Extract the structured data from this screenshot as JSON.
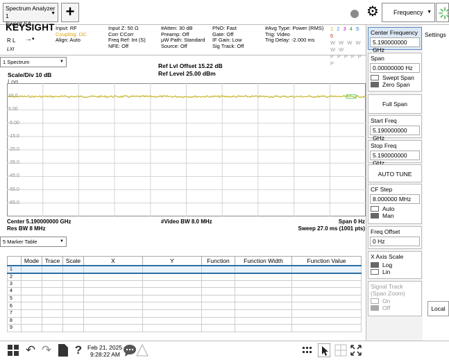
{
  "app_tab": {
    "title_line1": "Spectrum Analyzer 1",
    "title_line2": "Swept SA"
  },
  "toolbar": {
    "add": "+",
    "menu_select": "Frequency"
  },
  "meas_bar": {
    "brand": "KEYSIGHT",
    "rl": "R L",
    "lxi": "LXI",
    "col1": [
      "Input: RF",
      "Coupling: DC",
      "Align: Auto"
    ],
    "col2": [
      "Input Z: 50 Ω",
      "Corr CCorr",
      "Freq Ref: Int (S)",
      "NFE: Off"
    ],
    "col3": [
      "#Atten: 30 dB",
      "Preamp: Off",
      "μW Path: Standard",
      "Source: Off"
    ],
    "col4": [
      "PNO: Fast",
      "Gate: Off",
      "IF Gain: Low",
      "Sig Track: Off"
    ],
    "col5": [
      "#Avg Type: Power (RMS)",
      "Trig: Video",
      "Trig Delay: -2.000 ms"
    ],
    "trace_numbers": [
      "1",
      "2",
      "3",
      "4",
      "5",
      "6"
    ],
    "trace_types": "W W W W W W",
    "trace_det": "P P P P P P"
  },
  "window": {
    "select": "1 Spectrum",
    "ref_offset": "Ref Lvl Offset 15.22 dB",
    "ref_level": "Ref Level 25.00 dBm",
    "scale_div": "Scale/Div 10 dB",
    "log": "Log",
    "center": "Center 5.190000000 GHz",
    "res_bw": "Res BW 8 MHz",
    "video_bw": "#Video BW 8.0 MHz",
    "span": "Span 0 Hz",
    "sweep": "Sweep 27.0 ms (1001 pts)"
  },
  "chart_data": {
    "type": "line",
    "title": "",
    "xlabel": "",
    "ylabel": "",
    "y_tick_labels": [
      "15.0",
      "5.00",
      "-5.00",
      "-15.0",
      "-25.0",
      "-35.0",
      "-45.0",
      "-55.0",
      "-65.0"
    ],
    "ylim": [
      -75,
      25
    ],
    "grid": true,
    "series": [
      {
        "color": "#c9b400",
        "level": 15.0
      }
    ]
  },
  "marker_table": {
    "select": "5 Marker Table",
    "headers": [
      "",
      "Mode",
      "Trace",
      "Scale",
      "X",
      "Y",
      "Function",
      "Function Width",
      "Function Value"
    ],
    "rows": [
      "1",
      "2",
      "3",
      "4",
      "5",
      "6",
      "7",
      "8",
      "9"
    ]
  },
  "menu": {
    "settings_tab": "Settings",
    "center_freq_title": "Center Frequency",
    "center_freq_value": "5.190000000 GHz",
    "span_title": "Span",
    "span_value": "0.00000000 Hz",
    "swept_span": "Swept Span",
    "zero_span": "Zero Span",
    "full_span": "Full Span",
    "start_freq_title": "Start Freq",
    "start_freq_value": "5.190000000 GHz",
    "stop_freq_title": "Stop Freq",
    "stop_freq_value": "5.190000000 GHz",
    "auto_tune": "AUTO TUNE",
    "cf_step_title": "CF Step",
    "cf_step_value": "8.000000 MHz",
    "cf_auto": "Auto",
    "cf_man": "Man",
    "freq_offset_title": "Freq Offset",
    "freq_offset_value": "0 Hz",
    "x_axis_title": "X Axis Scale",
    "x_log": "Log",
    "x_lin": "Lin",
    "signal_track_title": "Signal Track",
    "signal_track_sub": "(Span Zoom)",
    "st_on": "On",
    "st_off": "Off",
    "local": "Local"
  },
  "taskbar": {
    "date": "Feb 21, 2025",
    "time": "9:28:22 AM"
  }
}
